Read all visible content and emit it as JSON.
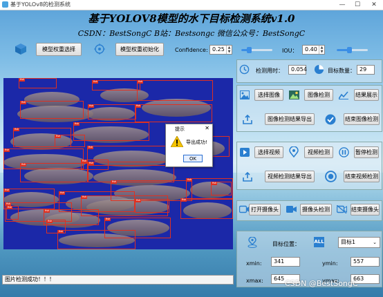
{
  "window": {
    "title": "基于YOLOv8的检测系统",
    "minimize": "—",
    "maximize": "☐",
    "close": "✕"
  },
  "header": {
    "title": "基于YOLOV8模型的水下目标检测系统v1.0",
    "subtitle": "CSDN：BestSongC   B站：Bestsongc   微信公众号：BestSongC"
  },
  "toolbar": {
    "model_select": "模型权重选择",
    "model_init": "模型权重初始化",
    "confidence_label": "Confidence:",
    "confidence_value": "0.25",
    "confidence_level": 0.25,
    "iou_label": "IOU：",
    "iou_value": "0.40",
    "iou_level": 0.4
  },
  "stats": {
    "time_label": "检测用时：",
    "time_value": "0.054",
    "count_label": "目标数量：",
    "count_value": "29"
  },
  "image_buttons": {
    "select": "选择图像",
    "detect": "图像检测",
    "show": "结果展示",
    "export": "图像检测结果导出",
    "end": "结束图像检测"
  },
  "video_buttons": {
    "select": "选择视频",
    "detect": "视频检测",
    "pause": "暂停检测",
    "export": "视频检测结果导出",
    "end": "结束视频检测"
  },
  "camera_buttons": {
    "open": "打开摄像头",
    "detect": "摄像头检测",
    "close": "结束摄像头"
  },
  "target": {
    "position_label": "目标位置：",
    "select_value": "目标1",
    "xmin_label": "xmin:",
    "xmin": "341",
    "ymin_label": "ymin:",
    "ymin": "557",
    "xmax_label": "xmax:",
    "xmax": "645",
    "ymax_label": "ymax:",
    "ymax": "663"
  },
  "dialog": {
    "title": "提示",
    "message": "导出成功!",
    "ok": "OK",
    "close": "✕"
  },
  "status": {
    "text": "图片检测成功！！！"
  },
  "watermark": "CSDN @BestSongC",
  "detection_label": "fish"
}
